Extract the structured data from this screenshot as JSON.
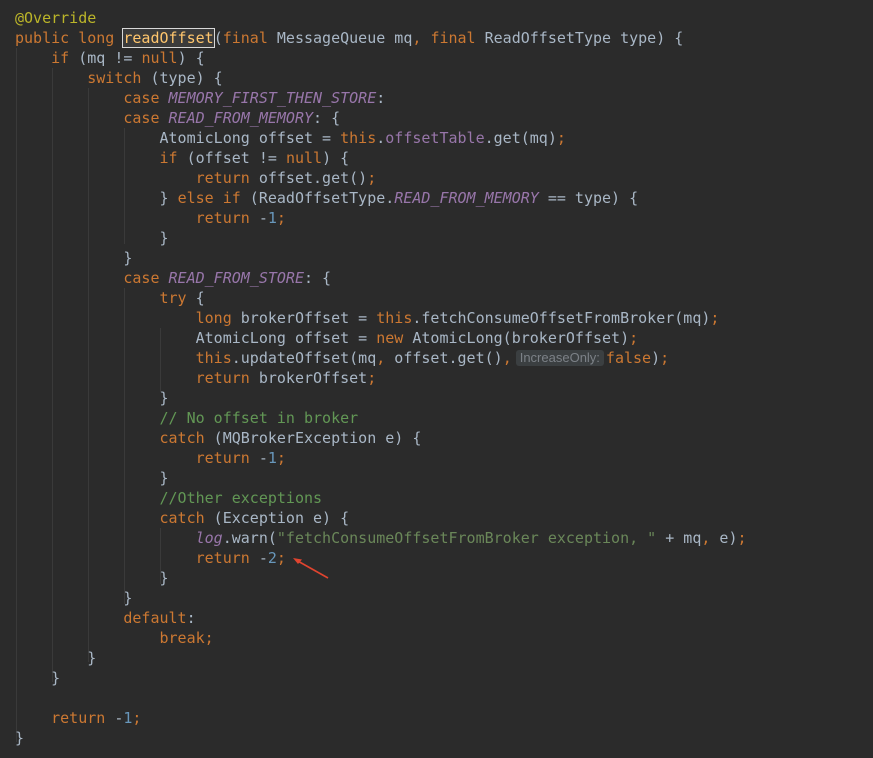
{
  "editor": {
    "lines": [
      [
        {
          "t": "@Override",
          "k": "ann"
        }
      ],
      [
        {
          "t": "public",
          "k": "kw"
        },
        {
          "t": " ",
          "k": "plain"
        },
        {
          "t": "long",
          "k": "kw"
        },
        {
          "t": " ",
          "k": "plain"
        },
        {
          "t": "readOffset",
          "k": "method-hl"
        },
        {
          "t": "(",
          "k": "plain"
        },
        {
          "t": "final",
          "k": "kw"
        },
        {
          "t": " MessageQueue mq",
          "k": "plain"
        },
        {
          "t": ",",
          "k": "kw"
        },
        {
          "t": " ",
          "k": "plain"
        },
        {
          "t": "final",
          "k": "kw"
        },
        {
          "t": " ReadOffsetType type) {",
          "k": "plain"
        }
      ],
      [
        {
          "t": "    ",
          "k": "plain"
        },
        {
          "t": "if",
          "k": "kw"
        },
        {
          "t": " (mq != ",
          "k": "plain"
        },
        {
          "t": "null",
          "k": "kw"
        },
        {
          "t": ") {",
          "k": "plain"
        }
      ],
      [
        {
          "t": "        ",
          "k": "plain"
        },
        {
          "t": "switch",
          "k": "kw"
        },
        {
          "t": " (type) {",
          "k": "plain"
        }
      ],
      [
        {
          "t": "            ",
          "k": "plain"
        },
        {
          "t": "case",
          "k": "kw"
        },
        {
          "t": " ",
          "k": "plain"
        },
        {
          "t": "MEMORY_FIRST_THEN_STORE",
          "k": "const"
        },
        {
          "t": ":",
          "k": "plain"
        }
      ],
      [
        {
          "t": "            ",
          "k": "plain"
        },
        {
          "t": "case",
          "k": "kw"
        },
        {
          "t": " ",
          "k": "plain"
        },
        {
          "t": "READ_FROM_MEMORY",
          "k": "const"
        },
        {
          "t": ": {",
          "k": "plain"
        }
      ],
      [
        {
          "t": "                AtomicLong offset = ",
          "k": "plain"
        },
        {
          "t": "this",
          "k": "kw"
        },
        {
          "t": ".",
          "k": "plain"
        },
        {
          "t": "offsetTable",
          "k": "fld"
        },
        {
          "t": ".get(mq)",
          "k": "plain"
        },
        {
          "t": ";",
          "k": "kw"
        }
      ],
      [
        {
          "t": "                ",
          "k": "plain"
        },
        {
          "t": "if",
          "k": "kw"
        },
        {
          "t": " (offset != ",
          "k": "plain"
        },
        {
          "t": "null",
          "k": "kw"
        },
        {
          "t": ") {",
          "k": "plain"
        }
      ],
      [
        {
          "t": "                    ",
          "k": "plain"
        },
        {
          "t": "return",
          "k": "kw"
        },
        {
          "t": " offset.get()",
          "k": "plain"
        },
        {
          "t": ";",
          "k": "kw"
        }
      ],
      [
        {
          "t": "                } ",
          "k": "plain"
        },
        {
          "t": "else if",
          "k": "kw"
        },
        {
          "t": " (ReadOffsetType.",
          "k": "plain"
        },
        {
          "t": "READ_FROM_MEMORY",
          "k": "const"
        },
        {
          "t": " == type) {",
          "k": "plain"
        }
      ],
      [
        {
          "t": "                    ",
          "k": "plain"
        },
        {
          "t": "return",
          "k": "kw"
        },
        {
          "t": " -",
          "k": "plain"
        },
        {
          "t": "1",
          "k": "num"
        },
        {
          "t": ";",
          "k": "kw"
        }
      ],
      [
        {
          "t": "                }",
          "k": "plain"
        }
      ],
      [
        {
          "t": "            }",
          "k": "plain"
        }
      ],
      [
        {
          "t": "            ",
          "k": "plain"
        },
        {
          "t": "case",
          "k": "kw"
        },
        {
          "t": " ",
          "k": "plain"
        },
        {
          "t": "READ_FROM_STORE",
          "k": "const"
        },
        {
          "t": ": {",
          "k": "plain"
        }
      ],
      [
        {
          "t": "                ",
          "k": "plain"
        },
        {
          "t": "try",
          "k": "kw"
        },
        {
          "t": " {",
          "k": "plain"
        }
      ],
      [
        {
          "t": "                    ",
          "k": "plain"
        },
        {
          "t": "long",
          "k": "kw"
        },
        {
          "t": " brokerOffset = ",
          "k": "plain"
        },
        {
          "t": "this",
          "k": "kw"
        },
        {
          "t": ".fetchConsumeOffsetFromBroker(mq)",
          "k": "plain"
        },
        {
          "t": ";",
          "k": "kw"
        }
      ],
      [
        {
          "t": "                    AtomicLong offset = ",
          "k": "plain"
        },
        {
          "t": "new",
          "k": "kw"
        },
        {
          "t": " AtomicLong(brokerOffset)",
          "k": "plain"
        },
        {
          "t": ";",
          "k": "kw"
        }
      ],
      [
        {
          "t": "                    ",
          "k": "plain"
        },
        {
          "t": "this",
          "k": "kw"
        },
        {
          "t": ".updateOffset(mq",
          "k": "plain"
        },
        {
          "t": ",",
          "k": "kw"
        },
        {
          "t": " offset.get()",
          "k": "plain"
        },
        {
          "t": ",",
          "k": "kw"
        },
        {
          "t": "IncreaseOnly:",
          "k": "hint"
        },
        {
          "t": "false",
          "k": "kw"
        },
        {
          "t": ")",
          "k": "plain"
        },
        {
          "t": ";",
          "k": "kw"
        }
      ],
      [
        {
          "t": "                    ",
          "k": "plain"
        },
        {
          "t": "return",
          "k": "kw"
        },
        {
          "t": " brokerOffset",
          "k": "plain"
        },
        {
          "t": ";",
          "k": "kw"
        }
      ],
      [
        {
          "t": "                }",
          "k": "plain"
        }
      ],
      [
        {
          "t": "                ",
          "k": "plain"
        },
        {
          "t": "// No offset in broker",
          "k": "cmt"
        }
      ],
      [
        {
          "t": "                ",
          "k": "plain"
        },
        {
          "t": "catch",
          "k": "kw"
        },
        {
          "t": " (MQBrokerException e) {",
          "k": "plain"
        }
      ],
      [
        {
          "t": "                    ",
          "k": "plain"
        },
        {
          "t": "return",
          "k": "kw"
        },
        {
          "t": " -",
          "k": "plain"
        },
        {
          "t": "1",
          "k": "num"
        },
        {
          "t": ";",
          "k": "kw"
        }
      ],
      [
        {
          "t": "                }",
          "k": "plain"
        }
      ],
      [
        {
          "t": "                ",
          "k": "plain"
        },
        {
          "t": "//Other exceptions",
          "k": "cmt"
        }
      ],
      [
        {
          "t": "                ",
          "k": "plain"
        },
        {
          "t": "catch",
          "k": "kw"
        },
        {
          "t": " (Exception e) {",
          "k": "plain"
        }
      ],
      [
        {
          "t": "                    ",
          "k": "plain"
        },
        {
          "t": "log",
          "k": "const"
        },
        {
          "t": ".warn(",
          "k": "plain"
        },
        {
          "t": "\"fetchConsumeOffsetFromBroker exception, \"",
          "k": "str"
        },
        {
          "t": " + mq",
          "k": "plain"
        },
        {
          "t": ",",
          "k": "kw"
        },
        {
          "t": " e)",
          "k": "plain"
        },
        {
          "t": ";",
          "k": "kw"
        }
      ],
      [
        {
          "t": "                    ",
          "k": "plain"
        },
        {
          "t": "return",
          "k": "kw"
        },
        {
          "t": " -",
          "k": "plain"
        },
        {
          "t": "2",
          "k": "num"
        },
        {
          "t": ";",
          "k": "kw"
        }
      ],
      [
        {
          "t": "                }",
          "k": "plain"
        }
      ],
      [
        {
          "t": "            }",
          "k": "plain"
        }
      ],
      [
        {
          "t": "            ",
          "k": "plain"
        },
        {
          "t": "default",
          "k": "kw"
        },
        {
          "t": ":",
          "k": "plain"
        }
      ],
      [
        {
          "t": "                ",
          "k": "plain"
        },
        {
          "t": "break;",
          "k": "kw"
        }
      ],
      [
        {
          "t": "        }",
          "k": "plain"
        }
      ],
      [
        {
          "t": "    }",
          "k": "plain"
        }
      ],
      [
        {
          "t": "",
          "k": "plain"
        }
      ],
      [
        {
          "t": "    ",
          "k": "plain"
        },
        {
          "t": "return",
          "k": "kw"
        },
        {
          "t": " -",
          "k": "plain"
        },
        {
          "t": "1",
          "k": "num"
        },
        {
          "t": ";",
          "k": "kw"
        }
      ],
      [
        {
          "t": "}",
          "k": "plain"
        }
      ]
    ]
  },
  "colors": {
    "background": "#2b2b2b",
    "keyword": "#cc7832",
    "annotation": "#bbb529",
    "constant": "#9876aa",
    "comment": "#629755",
    "string": "#6a8759",
    "number": "#6897bb",
    "text": "#a9b7c6",
    "arrow": "#e0442f"
  }
}
